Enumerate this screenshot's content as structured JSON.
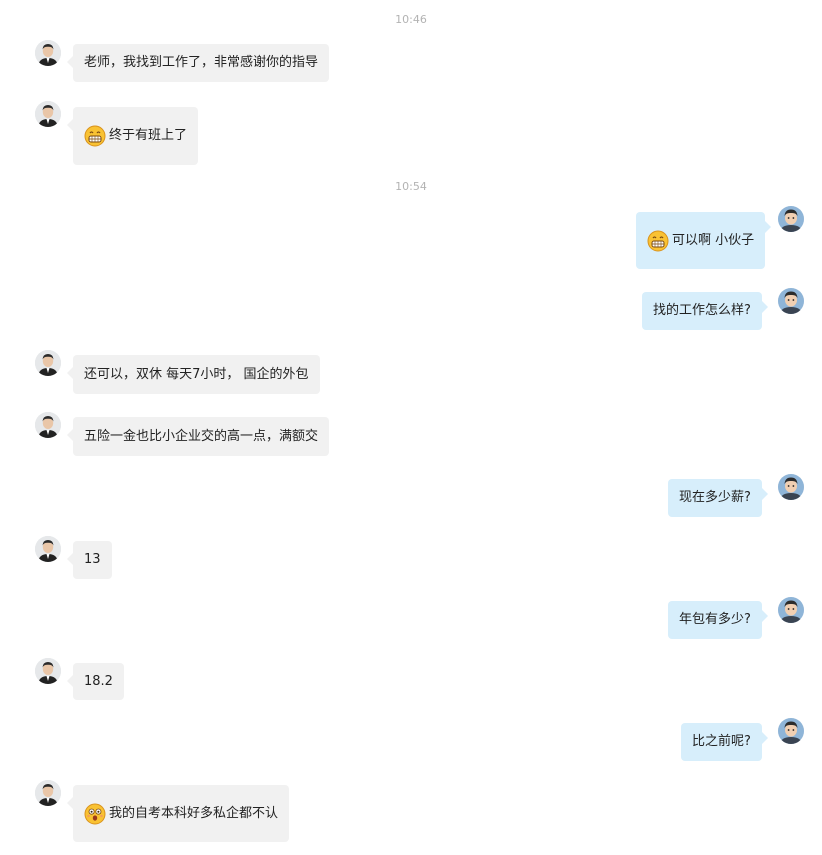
{
  "timestamps": [
    "10:46",
    "10:54"
  ],
  "messages": [
    {
      "side": "left",
      "text": "老师，我找到工作了，非常感谢你的指导"
    },
    {
      "side": "left",
      "emoji": "grinning-emoji",
      "text": "终于有班上了"
    },
    {
      "side": "right",
      "emoji": "grinning-emoji",
      "text": "可以啊 小伙子"
    },
    {
      "side": "right",
      "text": "找的工作怎么样?"
    },
    {
      "side": "left",
      "text": "还可以，双休 每天7小时， 国企的外包"
    },
    {
      "side": "left",
      "text": "五险一金也比小企业交的高一点，满额交"
    },
    {
      "side": "right",
      "text": "现在多少薪?"
    },
    {
      "side": "left",
      "text": "13"
    },
    {
      "side": "right",
      "text": "年包有多少?"
    },
    {
      "side": "left",
      "text": "18.2"
    },
    {
      "side": "right",
      "text": "比之前呢?"
    },
    {
      "side": "left",
      "emoji": "shocked-emoji",
      "text": "我的自考本科好多私企都不认"
    }
  ],
  "colors": {
    "left_bubble": "#f1f1f1",
    "right_bubble": "#d7eefb",
    "timestamp": "#b3b3b3"
  }
}
